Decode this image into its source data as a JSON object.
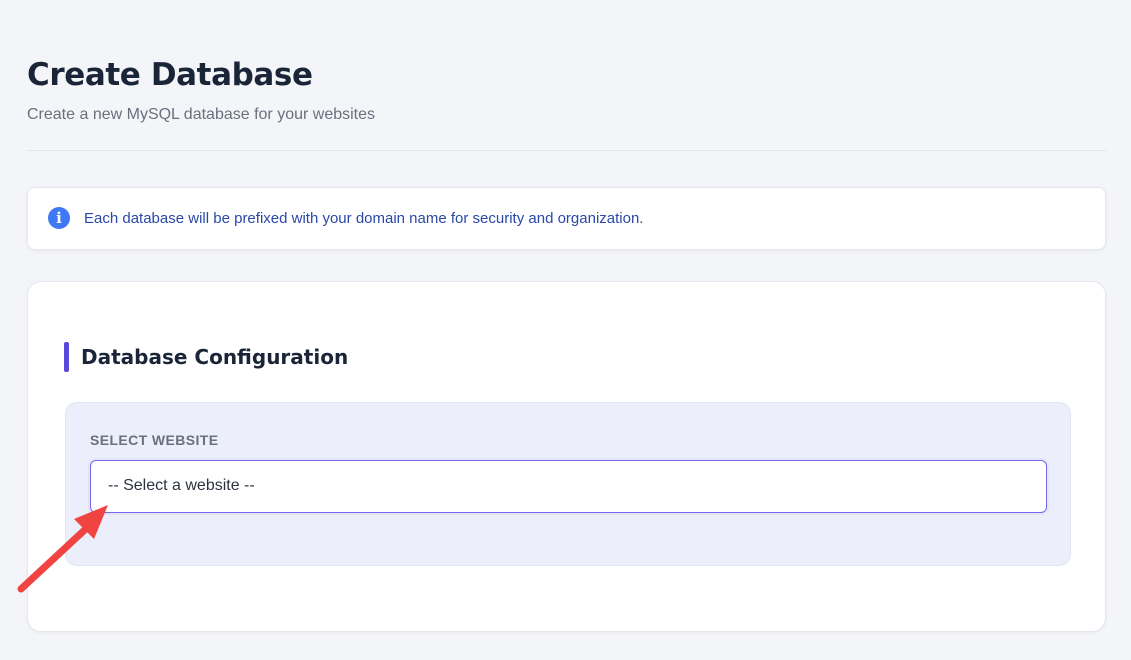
{
  "page": {
    "title": "Create Database",
    "subtitle": "Create a new MySQL database for your websites"
  },
  "info_banner": {
    "icon": "info-icon",
    "icon_glyph": "i",
    "message": "Each database will be prefixed with your domain name for security and organization."
  },
  "configuration": {
    "title": "Database Configuration",
    "website_select": {
      "label": "SELECT WEBSITE",
      "selected_value": "-- Select a website --"
    }
  },
  "annotation": {
    "icon": "red-arrow-icon",
    "color": "#f04443"
  },
  "colors": {
    "background": "#f4f5f9",
    "accent": "#5a48d8",
    "info": "#3e78f2",
    "info_text": "#2948a8"
  }
}
